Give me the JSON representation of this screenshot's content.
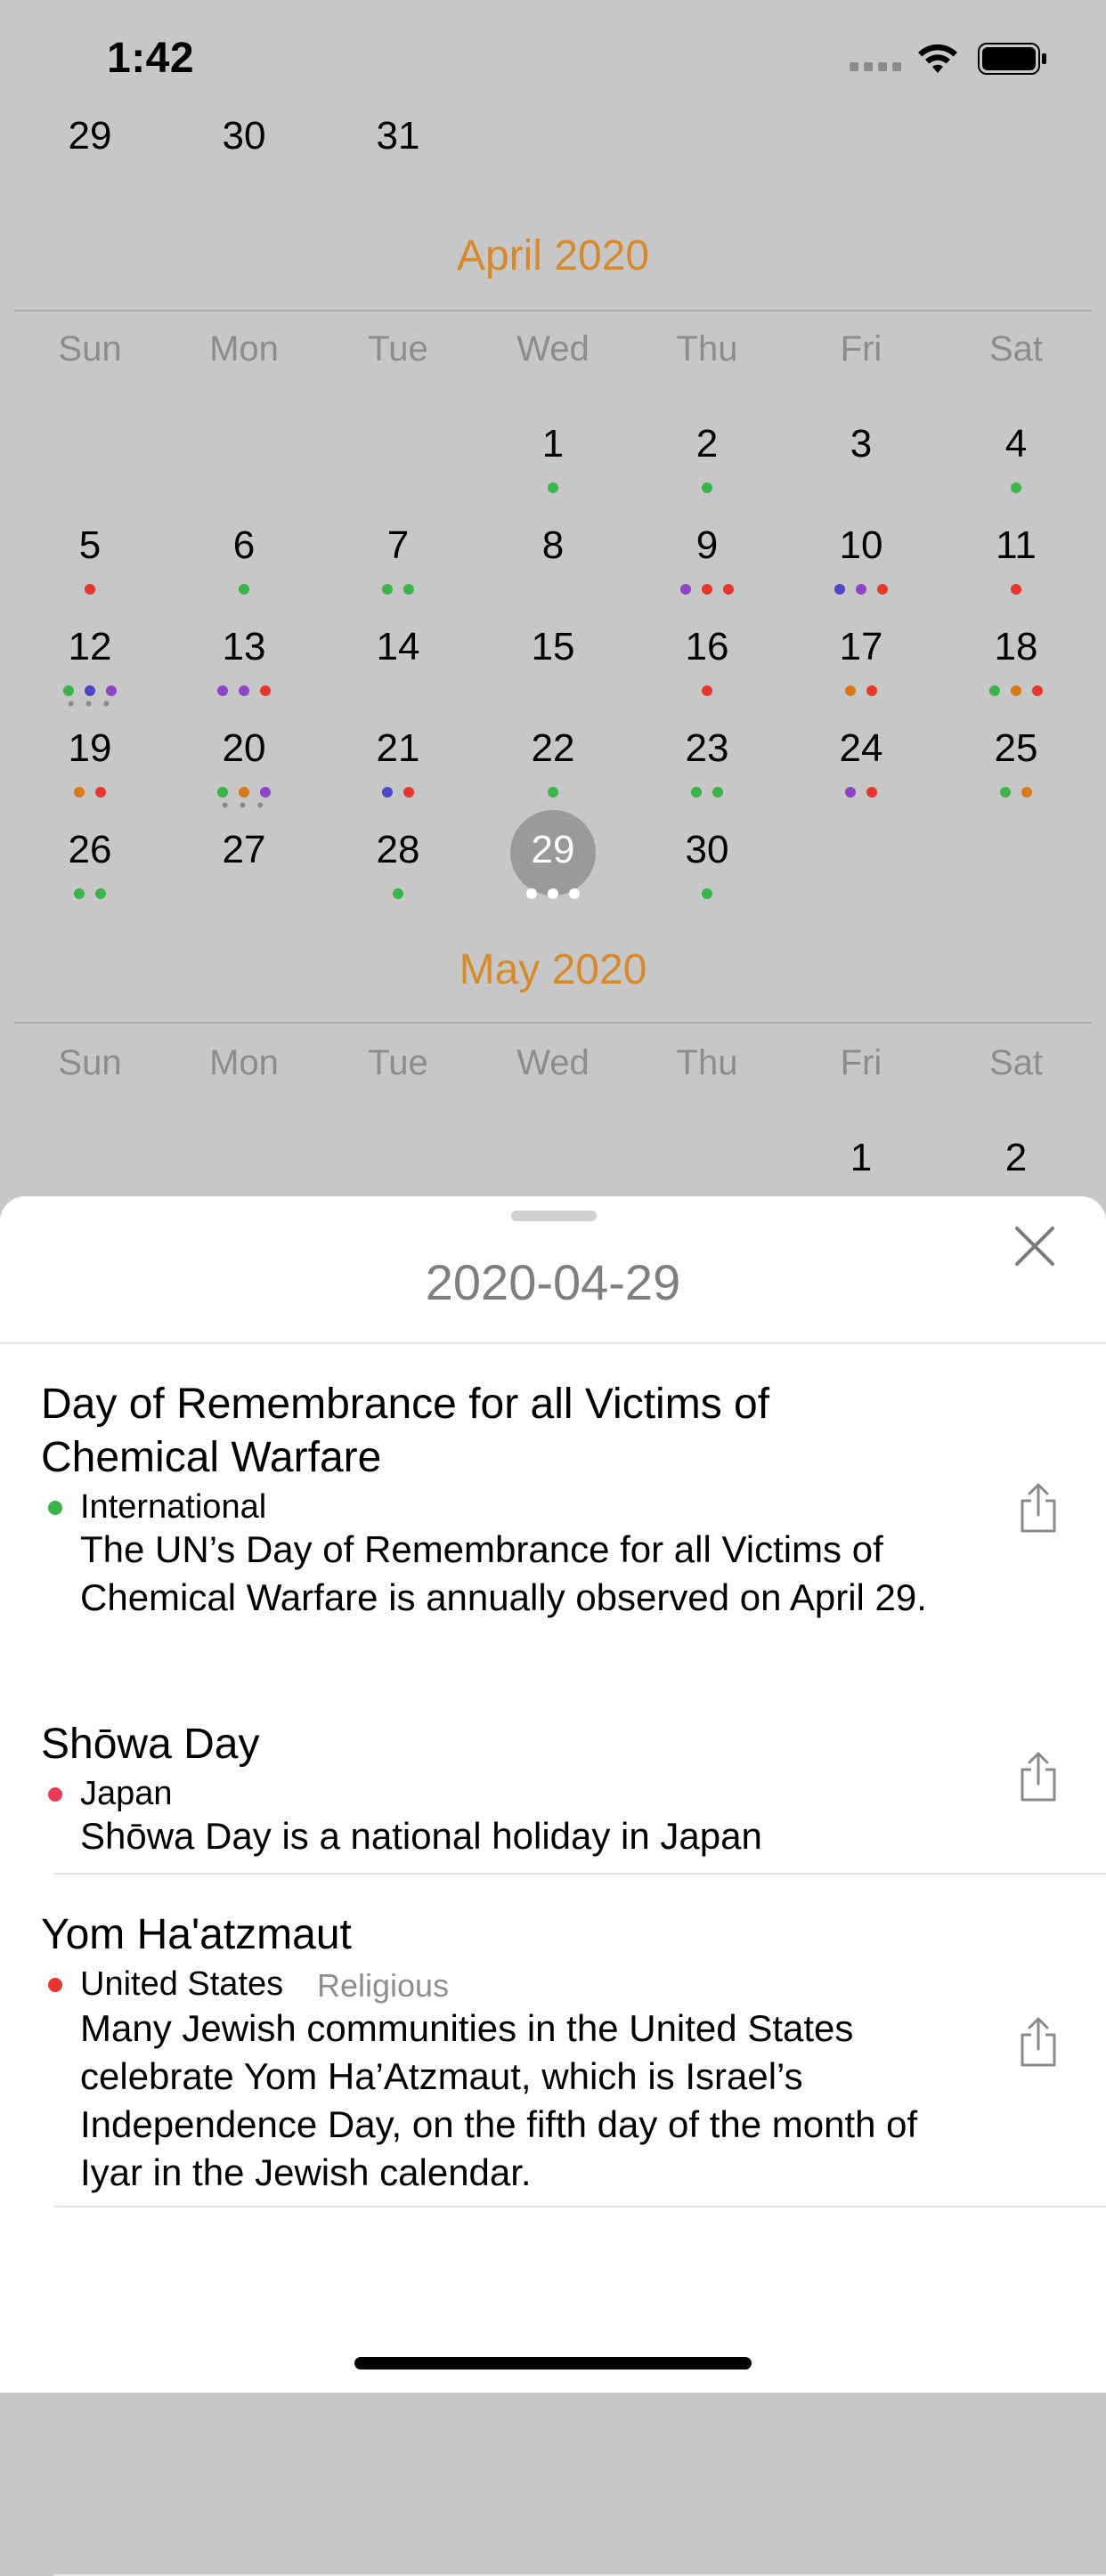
{
  "status_bar": {
    "time": "1:42"
  },
  "colors": {
    "green": "#3bb44a",
    "red": "#e8352e",
    "purple": "#8e44c4",
    "blue": "#4a48c4",
    "orange": "#d77a18",
    "accent": "#d58a2d",
    "pink": "#e53a5a"
  },
  "prev_month_tail": [
    "29",
    "30",
    "31"
  ],
  "april": {
    "title": "April 2020",
    "weekdays": [
      "Sun",
      "Mon",
      "Tue",
      "Wed",
      "Thu",
      "Fri",
      "Sat"
    ],
    "selected_day": "29",
    "days": [
      {
        "d": "1",
        "col": 3,
        "row": 0,
        "dots": [
          "green"
        ]
      },
      {
        "d": "2",
        "col": 4,
        "row": 0,
        "dots": [
          "green"
        ]
      },
      {
        "d": "3",
        "col": 5,
        "row": 0,
        "dots": []
      },
      {
        "d": "4",
        "col": 6,
        "row": 0,
        "dots": [
          "green"
        ]
      },
      {
        "d": "5",
        "col": 0,
        "row": 1,
        "dots": [
          "red"
        ]
      },
      {
        "d": "6",
        "col": 1,
        "row": 1,
        "dots": [
          "green"
        ]
      },
      {
        "d": "7",
        "col": 2,
        "row": 1,
        "dots": [
          "green",
          "green"
        ]
      },
      {
        "d": "8",
        "col": 3,
        "row": 1,
        "dots": []
      },
      {
        "d": "9",
        "col": 4,
        "row": 1,
        "dots": [
          "purple",
          "red",
          "red"
        ]
      },
      {
        "d": "10",
        "col": 5,
        "row": 1,
        "dots": [
          "blue",
          "purple",
          "red"
        ]
      },
      {
        "d": "11",
        "col": 6,
        "row": 1,
        "dots": [
          "red"
        ]
      },
      {
        "d": "12",
        "col": 0,
        "row": 2,
        "dots": [
          "green",
          "blue",
          "purple"
        ],
        "more": true
      },
      {
        "d": "13",
        "col": 1,
        "row": 2,
        "dots": [
          "purple",
          "purple",
          "red"
        ]
      },
      {
        "d": "14",
        "col": 2,
        "row": 2,
        "dots": []
      },
      {
        "d": "15",
        "col": 3,
        "row": 2,
        "dots": []
      },
      {
        "d": "16",
        "col": 4,
        "row": 2,
        "dots": [
          "red"
        ]
      },
      {
        "d": "17",
        "col": 5,
        "row": 2,
        "dots": [
          "orange",
          "red"
        ]
      },
      {
        "d": "18",
        "col": 6,
        "row": 2,
        "dots": [
          "green",
          "orange",
          "red"
        ]
      },
      {
        "d": "19",
        "col": 0,
        "row": 3,
        "dots": [
          "orange",
          "red"
        ]
      },
      {
        "d": "20",
        "col": 1,
        "row": 3,
        "dots": [
          "green",
          "orange",
          "purple"
        ],
        "more": true
      },
      {
        "d": "21",
        "col": 2,
        "row": 3,
        "dots": [
          "blue",
          "red"
        ]
      },
      {
        "d": "22",
        "col": 3,
        "row": 3,
        "dots": [
          "green"
        ]
      },
      {
        "d": "23",
        "col": 4,
        "row": 3,
        "dots": [
          "green",
          "green"
        ]
      },
      {
        "d": "24",
        "col": 5,
        "row": 3,
        "dots": [
          "purple",
          "red"
        ]
      },
      {
        "d": "25",
        "col": 6,
        "row": 3,
        "dots": [
          "green",
          "orange"
        ]
      },
      {
        "d": "26",
        "col": 0,
        "row": 4,
        "dots": [
          "green",
          "green"
        ]
      },
      {
        "d": "27",
        "col": 1,
        "row": 4,
        "dots": []
      },
      {
        "d": "28",
        "col": 2,
        "row": 4,
        "dots": [
          "green"
        ]
      },
      {
        "d": "29",
        "col": 3,
        "row": 4,
        "dots": [
          "white",
          "white",
          "white"
        ],
        "selected": true
      },
      {
        "d": "30",
        "col": 4,
        "row": 4,
        "dots": [
          "green"
        ]
      }
    ]
  },
  "may": {
    "title": "May 2020",
    "weekdays": [
      "Sun",
      "Mon",
      "Tue",
      "Wed",
      "Thu",
      "Fri",
      "Sat"
    ],
    "days": [
      {
        "d": "1",
        "col": 5,
        "row": 0,
        "dots": [
          "blue",
          "orange",
          "purple"
        ]
      },
      {
        "d": "2",
        "col": 6,
        "row": 0,
        "dots": [
          "green"
        ]
      }
    ]
  },
  "sheet": {
    "date": "2020-04-29",
    "events": [
      {
        "title": "Day of Remembrance for all Victims of Chemical Warfare",
        "tag": "International",
        "tag_color": "green",
        "category": "",
        "description": "The UN’s Day of Remembrance for all Victims of Chemical Warfare is annually observed on April 29."
      },
      {
        "title": "Shōwa Day",
        "tag": "Japan",
        "tag_color": "pink",
        "category": "",
        "description": "Shōwa Day is a national holiday in Japan"
      },
      {
        "title": "Yom Ha'atzmaut",
        "tag": "United States",
        "tag_color": "red",
        "category": "Religious",
        "description": "Many Jewish communities in the United States celebrate Yom Ha’Atzmaut, which is Israel’s Independence Day, on the fifth day of the month of Iyar in the Jewish calendar."
      }
    ]
  }
}
